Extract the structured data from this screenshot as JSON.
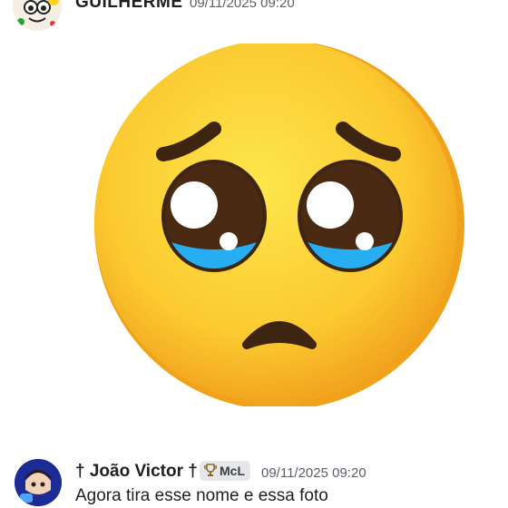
{
  "messages": [
    {
      "author": "GUILHERME",
      "timestamp": "09/11/2025 09:20",
      "attachment_icon": "pleading-face-emoji"
    },
    {
      "author": "† João Victor †",
      "tag_label": "McL",
      "tag_icon": "trophy-icon",
      "timestamp": "09/11/2025 09:20",
      "content": "Agora tira esse nome e essa foto"
    }
  ],
  "colors": {
    "face": "#fbc02d",
    "tears": "#29b6f6",
    "text": "#1e1f22",
    "timestamp": "#5c5e66"
  }
}
